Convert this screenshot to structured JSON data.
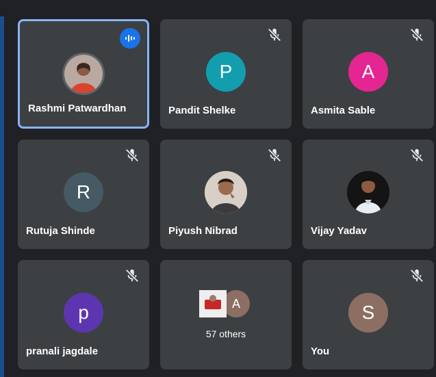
{
  "meeting": {
    "tiles": [
      {
        "name": "Rashmi Patwardhan",
        "speaking": true,
        "muted": false,
        "avatar_type": "photo"
      },
      {
        "name": "Pandit Shelke",
        "muted": true,
        "initial": "P",
        "avatar_color": "#129eaf"
      },
      {
        "name": "Asmita Sable",
        "muted": true,
        "initial": "A",
        "avatar_color": "#e52592"
      },
      {
        "name": "Rutuja Shinde",
        "muted": true,
        "initial": "R",
        "avatar_color": "#455a64"
      },
      {
        "name": "Piyush Nibrad",
        "muted": true,
        "avatar_type": "photo"
      },
      {
        "name": "Vijay Yadav",
        "muted": true,
        "avatar_type": "photo"
      },
      {
        "name": "pranali jagdale",
        "muted": true,
        "initial": "p",
        "avatar_color": "#5e35b1"
      },
      {
        "others_label": "57 others",
        "other_initial": "A"
      },
      {
        "name": "You",
        "muted": true,
        "initial": "S",
        "avatar_color": "#8d6e63"
      }
    ]
  },
  "icons": {
    "mic_off": "mic-off-icon",
    "speaking": "audio-wave-icon"
  },
  "colors": {
    "background": "#202124",
    "tile": "#3c4043",
    "speaking_border": "#8ab4f8",
    "accent": "#1a73e8"
  }
}
